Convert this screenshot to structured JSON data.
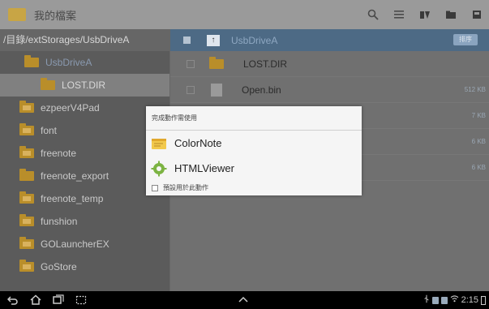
{
  "actionbar": {
    "title": "我的檔案",
    "actions": [
      "search-icon",
      "list-view-icon",
      "tools-icon",
      "folder-icon",
      "storage-icon"
    ]
  },
  "sidebar": {
    "path": "/目錄/extStorages/UsbDriveA",
    "items": [
      {
        "label": "UsbDriveA"
      },
      {
        "label": "LOST.DIR"
      },
      {
        "label": "ezpeerV4Pad"
      },
      {
        "label": "font"
      },
      {
        "label": "freenote"
      },
      {
        "label": "freenote_export"
      },
      {
        "label": "freenote_temp"
      },
      {
        "label": "funshion"
      },
      {
        "label": "GOLauncherEX"
      },
      {
        "label": "GoStore"
      }
    ]
  },
  "main": {
    "header": {
      "name": "UsbDriveA",
      "sort": "排序"
    },
    "files": [
      {
        "name": "LOST.DIR",
        "size": ""
      },
      {
        "name": "Open.bin",
        "size": "512 KB"
      },
      {
        "name": "",
        "size": "7 KB"
      },
      {
        "name": "",
        "size": "6 KB"
      },
      {
        "name": "",
        "size": "6 KB"
      }
    ]
  },
  "dialog": {
    "title": "完成動作需使用",
    "options": [
      {
        "label": "ColorNote"
      },
      {
        "label": "HTMLViewer"
      }
    ],
    "default_label": "預設用於此動作"
  },
  "status": {
    "time": "2:15"
  },
  "colors": {
    "action_bar": "#9a9a9a",
    "header_blue": "#4d6a85",
    "folder": "#b98e2a",
    "dialog_bg": "#f5f5f5"
  }
}
